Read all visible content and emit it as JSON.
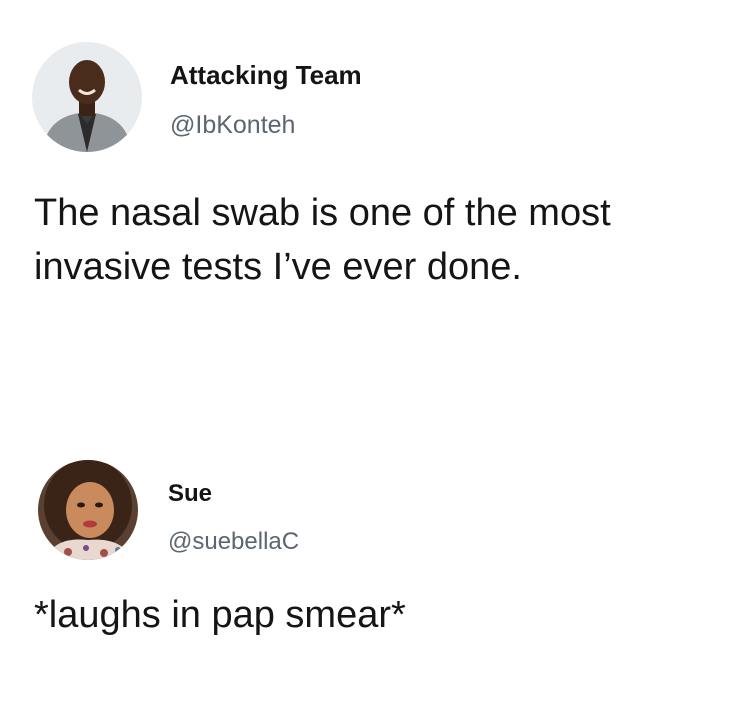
{
  "tweets": [
    {
      "display_name": "Attacking Team",
      "handle": "@IbKonteh",
      "text_lines": [
        "The nasal swab is one of the most",
        "invasive tests I’ve ever done."
      ]
    },
    {
      "display_name": "Sue",
      "handle": "@suebellaC",
      "text_lines": [
        "*laughs in pap smear*"
      ]
    }
  ],
  "colors": {
    "background": "#ffffff",
    "name": "#141414",
    "handle": "#5b6670",
    "text": "#151515"
  },
  "icons": [
    "avatar-photo-man",
    "avatar-photo-woman"
  ]
}
